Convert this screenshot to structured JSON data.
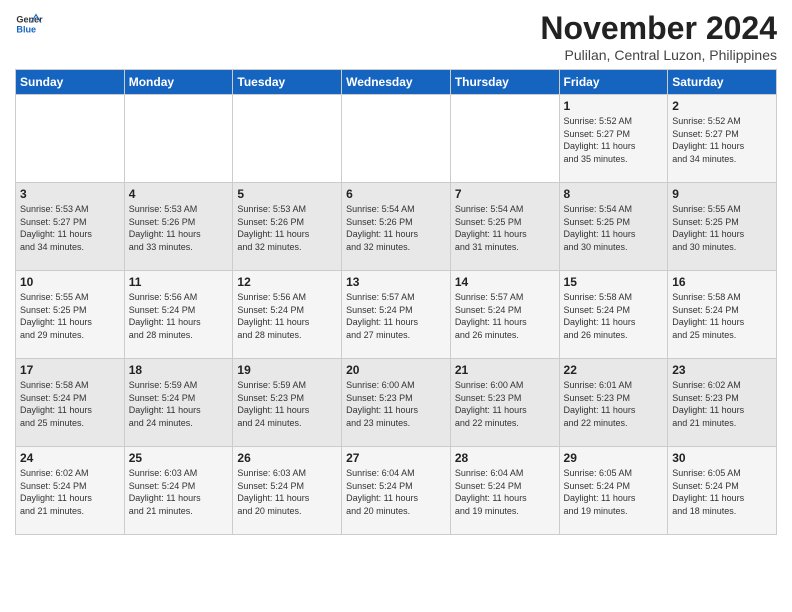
{
  "logo": {
    "general": "General",
    "blue": "Blue"
  },
  "header": {
    "month_year": "November 2024",
    "location": "Pulilan, Central Luzon, Philippines"
  },
  "weekdays": [
    "Sunday",
    "Monday",
    "Tuesday",
    "Wednesday",
    "Thursday",
    "Friday",
    "Saturday"
  ],
  "weeks": [
    [
      {
        "day": "",
        "info": ""
      },
      {
        "day": "",
        "info": ""
      },
      {
        "day": "",
        "info": ""
      },
      {
        "day": "",
        "info": ""
      },
      {
        "day": "",
        "info": ""
      },
      {
        "day": "1",
        "info": "Sunrise: 5:52 AM\nSunset: 5:27 PM\nDaylight: 11 hours\nand 35 minutes."
      },
      {
        "day": "2",
        "info": "Sunrise: 5:52 AM\nSunset: 5:27 PM\nDaylight: 11 hours\nand 34 minutes."
      }
    ],
    [
      {
        "day": "3",
        "info": "Sunrise: 5:53 AM\nSunset: 5:27 PM\nDaylight: 11 hours\nand 34 minutes."
      },
      {
        "day": "4",
        "info": "Sunrise: 5:53 AM\nSunset: 5:26 PM\nDaylight: 11 hours\nand 33 minutes."
      },
      {
        "day": "5",
        "info": "Sunrise: 5:53 AM\nSunset: 5:26 PM\nDaylight: 11 hours\nand 32 minutes."
      },
      {
        "day": "6",
        "info": "Sunrise: 5:54 AM\nSunset: 5:26 PM\nDaylight: 11 hours\nand 32 minutes."
      },
      {
        "day": "7",
        "info": "Sunrise: 5:54 AM\nSunset: 5:25 PM\nDaylight: 11 hours\nand 31 minutes."
      },
      {
        "day": "8",
        "info": "Sunrise: 5:54 AM\nSunset: 5:25 PM\nDaylight: 11 hours\nand 30 minutes."
      },
      {
        "day": "9",
        "info": "Sunrise: 5:55 AM\nSunset: 5:25 PM\nDaylight: 11 hours\nand 30 minutes."
      }
    ],
    [
      {
        "day": "10",
        "info": "Sunrise: 5:55 AM\nSunset: 5:25 PM\nDaylight: 11 hours\nand 29 minutes."
      },
      {
        "day": "11",
        "info": "Sunrise: 5:56 AM\nSunset: 5:24 PM\nDaylight: 11 hours\nand 28 minutes."
      },
      {
        "day": "12",
        "info": "Sunrise: 5:56 AM\nSunset: 5:24 PM\nDaylight: 11 hours\nand 28 minutes."
      },
      {
        "day": "13",
        "info": "Sunrise: 5:57 AM\nSunset: 5:24 PM\nDaylight: 11 hours\nand 27 minutes."
      },
      {
        "day": "14",
        "info": "Sunrise: 5:57 AM\nSunset: 5:24 PM\nDaylight: 11 hours\nand 26 minutes."
      },
      {
        "day": "15",
        "info": "Sunrise: 5:58 AM\nSunset: 5:24 PM\nDaylight: 11 hours\nand 26 minutes."
      },
      {
        "day": "16",
        "info": "Sunrise: 5:58 AM\nSunset: 5:24 PM\nDaylight: 11 hours\nand 25 minutes."
      }
    ],
    [
      {
        "day": "17",
        "info": "Sunrise: 5:58 AM\nSunset: 5:24 PM\nDaylight: 11 hours\nand 25 minutes."
      },
      {
        "day": "18",
        "info": "Sunrise: 5:59 AM\nSunset: 5:24 PM\nDaylight: 11 hours\nand 24 minutes."
      },
      {
        "day": "19",
        "info": "Sunrise: 5:59 AM\nSunset: 5:23 PM\nDaylight: 11 hours\nand 24 minutes."
      },
      {
        "day": "20",
        "info": "Sunrise: 6:00 AM\nSunset: 5:23 PM\nDaylight: 11 hours\nand 23 minutes."
      },
      {
        "day": "21",
        "info": "Sunrise: 6:00 AM\nSunset: 5:23 PM\nDaylight: 11 hours\nand 22 minutes."
      },
      {
        "day": "22",
        "info": "Sunrise: 6:01 AM\nSunset: 5:23 PM\nDaylight: 11 hours\nand 22 minutes."
      },
      {
        "day": "23",
        "info": "Sunrise: 6:02 AM\nSunset: 5:23 PM\nDaylight: 11 hours\nand 21 minutes."
      }
    ],
    [
      {
        "day": "24",
        "info": "Sunrise: 6:02 AM\nSunset: 5:24 PM\nDaylight: 11 hours\nand 21 minutes."
      },
      {
        "day": "25",
        "info": "Sunrise: 6:03 AM\nSunset: 5:24 PM\nDaylight: 11 hours\nand 21 minutes."
      },
      {
        "day": "26",
        "info": "Sunrise: 6:03 AM\nSunset: 5:24 PM\nDaylight: 11 hours\nand 20 minutes."
      },
      {
        "day": "27",
        "info": "Sunrise: 6:04 AM\nSunset: 5:24 PM\nDaylight: 11 hours\nand 20 minutes."
      },
      {
        "day": "28",
        "info": "Sunrise: 6:04 AM\nSunset: 5:24 PM\nDaylight: 11 hours\nand 19 minutes."
      },
      {
        "day": "29",
        "info": "Sunrise: 6:05 AM\nSunset: 5:24 PM\nDaylight: 11 hours\nand 19 minutes."
      },
      {
        "day": "30",
        "info": "Sunrise: 6:05 AM\nSunset: 5:24 PM\nDaylight: 11 hours\nand 18 minutes."
      }
    ]
  ]
}
